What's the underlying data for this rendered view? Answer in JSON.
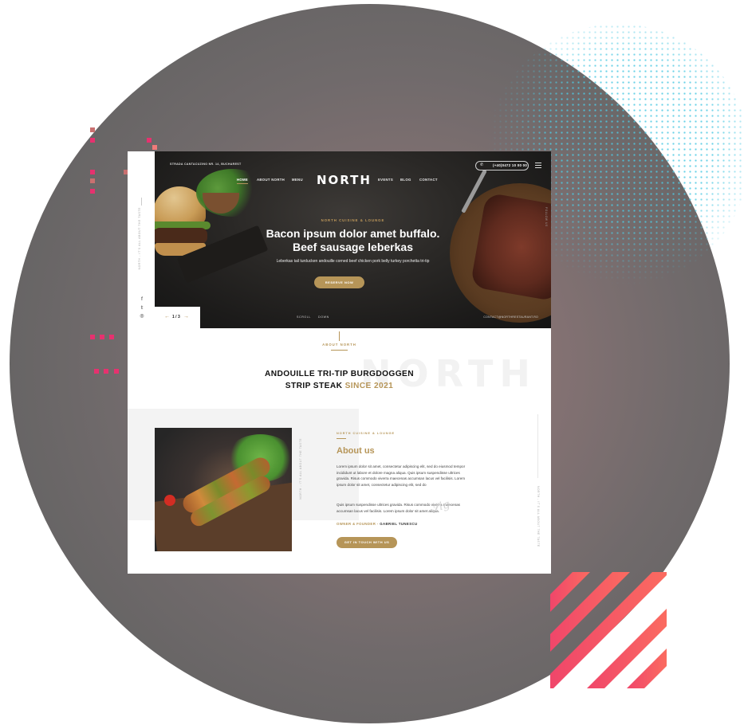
{
  "decor": {
    "stripe_color": "#fb6b60",
    "stripe_color_dark": "#f0466a",
    "pixel_colors": [
      "#e5326f",
      "#f07a7a",
      "#c97070"
    ]
  },
  "site": {
    "address": "STRADA CANTACUZINO NR. 14, BUCHAREST",
    "nav_left": [
      "HOME",
      "ABOUT NORTH",
      "MENU"
    ],
    "nav_right": [
      "EVENTS",
      "BLOG",
      "CONTACT"
    ],
    "logo": "NORTH",
    "phone": "(+40)0472 10 00 00",
    "phone_icon": "phone-icon",
    "hero": {
      "kicker": "NORTH CUISINE & LOUNGE",
      "title_line1": "Bacon ipsum dolor amet buffalo.",
      "title_line2": "Beef sausage leberkas",
      "subtitle": "Leberkas tail turducken andouille corned beef chicken pork belly turkey porchetta tri-tip",
      "button": "RESERVE NOW",
      "scroll_left": "SCROLL",
      "scroll_right": "DOWN",
      "email": "CONTACT@NORTHRESTAURANT.RO",
      "slide_counter": "1 / 3",
      "vertical_text": "FOLLOW US",
      "left_vertical_text": "NORTH - IT'S ALL ABOUT THE TASTE"
    },
    "social_icons": [
      "facebook-icon",
      "twitter-icon",
      "instagram-icon"
    ],
    "about": {
      "kicker": "ABOUT NORTH",
      "watermark": "NORTH",
      "title_line1": "ANDOUILLE TRI-TIP BURGDOGGEN",
      "title_line2_dark": "STRIP STEAK",
      "title_line2_gold": "SINCE 2021",
      "card_kicker": "NORTH CUISINE & LOUNGE",
      "card_title": "About us",
      "paragraph1": "Lorem ipsum dolor sit amet, consectetur adipiscing elit, sed do eiusmod tempor incididunt ut labore et dolore magna aliqua. Quis ipsum suspendisse ultrices gravida. Risus commodo viverra maecenas accumsan lacus vel facilisis. Lorem ipsum dolor sit amet, consectetur adipiscing elit, sed do",
      "paragraph2": "Quis ipsum suspendisse ultrices gravida. Risus commodo viverra maecenas accumsan lacus vel facilisis. Lorem ipsum dolor sit amet aliqua.",
      "owner_label": "OWNER & FOUNDER -",
      "owner_name": "GABRIEL TUNESCU",
      "button": "GET IN TOUCH WITH US",
      "image_vertical_text": "NORTH - IT'S ALL ABOUT THE TASTE",
      "right_vertical_text": "NORTH - IT'S ALL ABOUT THE TASTE"
    }
  }
}
